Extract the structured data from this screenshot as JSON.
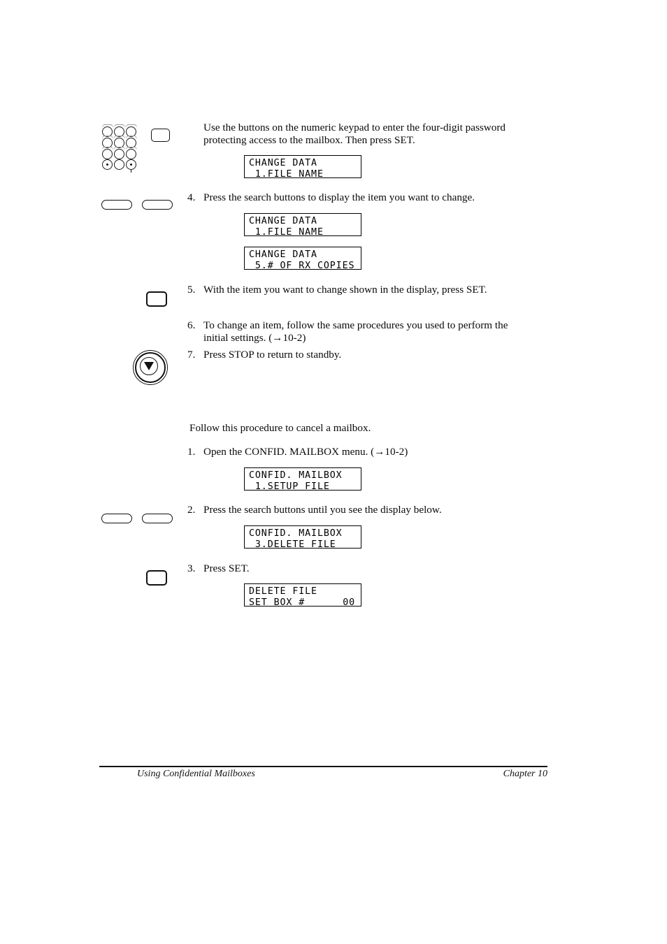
{
  "document": {
    "footer": {
      "left": "Using Confidential Mailboxes",
      "right": "Chapter 10"
    }
  },
  "section_change": {
    "intro": {
      "text": "Use the buttons on the numeric keypad to enter the four-digit password\nprotecting access to the mailbox. Then press SET.",
      "icon_keypad": "numeric-keypad-icon",
      "icon_button": "set-button-icon"
    },
    "intro_display": {
      "line1": "CHANGE DATA",
      "line2": " 1.FILE NAME"
    },
    "steps": [
      {
        "number": "4.",
        "text": "Press the search buttons to display the item you want to change.",
        "icon": "search-buttons-icon"
      },
      {
        "number": "5.",
        "text": "With the item you want to change shown in the display, press SET.",
        "icon": "set-button-icon"
      },
      {
        "number": "6.",
        "text": "To change an item, follow the same procedures you used to perform the\ninitial settings. (→10-2)",
        "icon": ""
      },
      {
        "number": "7.",
        "text": "Press STOP to return to standby.",
        "icon": "stop-button-icon"
      }
    ],
    "step4_display_a": {
      "line1": "CHANGE DATA",
      "line2": " 1.FILE NAME"
    },
    "step4_display_b": {
      "line1": "CHANGE DATA",
      "line2": " 5.# OF RX COPIES"
    }
  },
  "section_cancel": {
    "lead": "Follow this procedure to cancel a mailbox.",
    "steps": [
      {
        "number": "1.",
        "text": "Open the CONFID. MAILBOX menu. (→10-2)",
        "icon": ""
      },
      {
        "number": "2.",
        "text": "Press the search buttons until you see the display below.",
        "icon": "search-buttons-icon"
      },
      {
        "number": "3.",
        "text": "Press SET.",
        "icon": "set-button-icon"
      }
    ],
    "step1_display": {
      "line1": "CONFID. MAILBOX",
      "line2": " 1.SETUP FILE"
    },
    "step2_display": {
      "line1": "CONFID. MAILBOX",
      "line2": " 3.DELETE FILE"
    },
    "step3_display": {
      "line1": "DELETE FILE",
      "line2": "SET BOX #",
      "value": "00"
    }
  }
}
